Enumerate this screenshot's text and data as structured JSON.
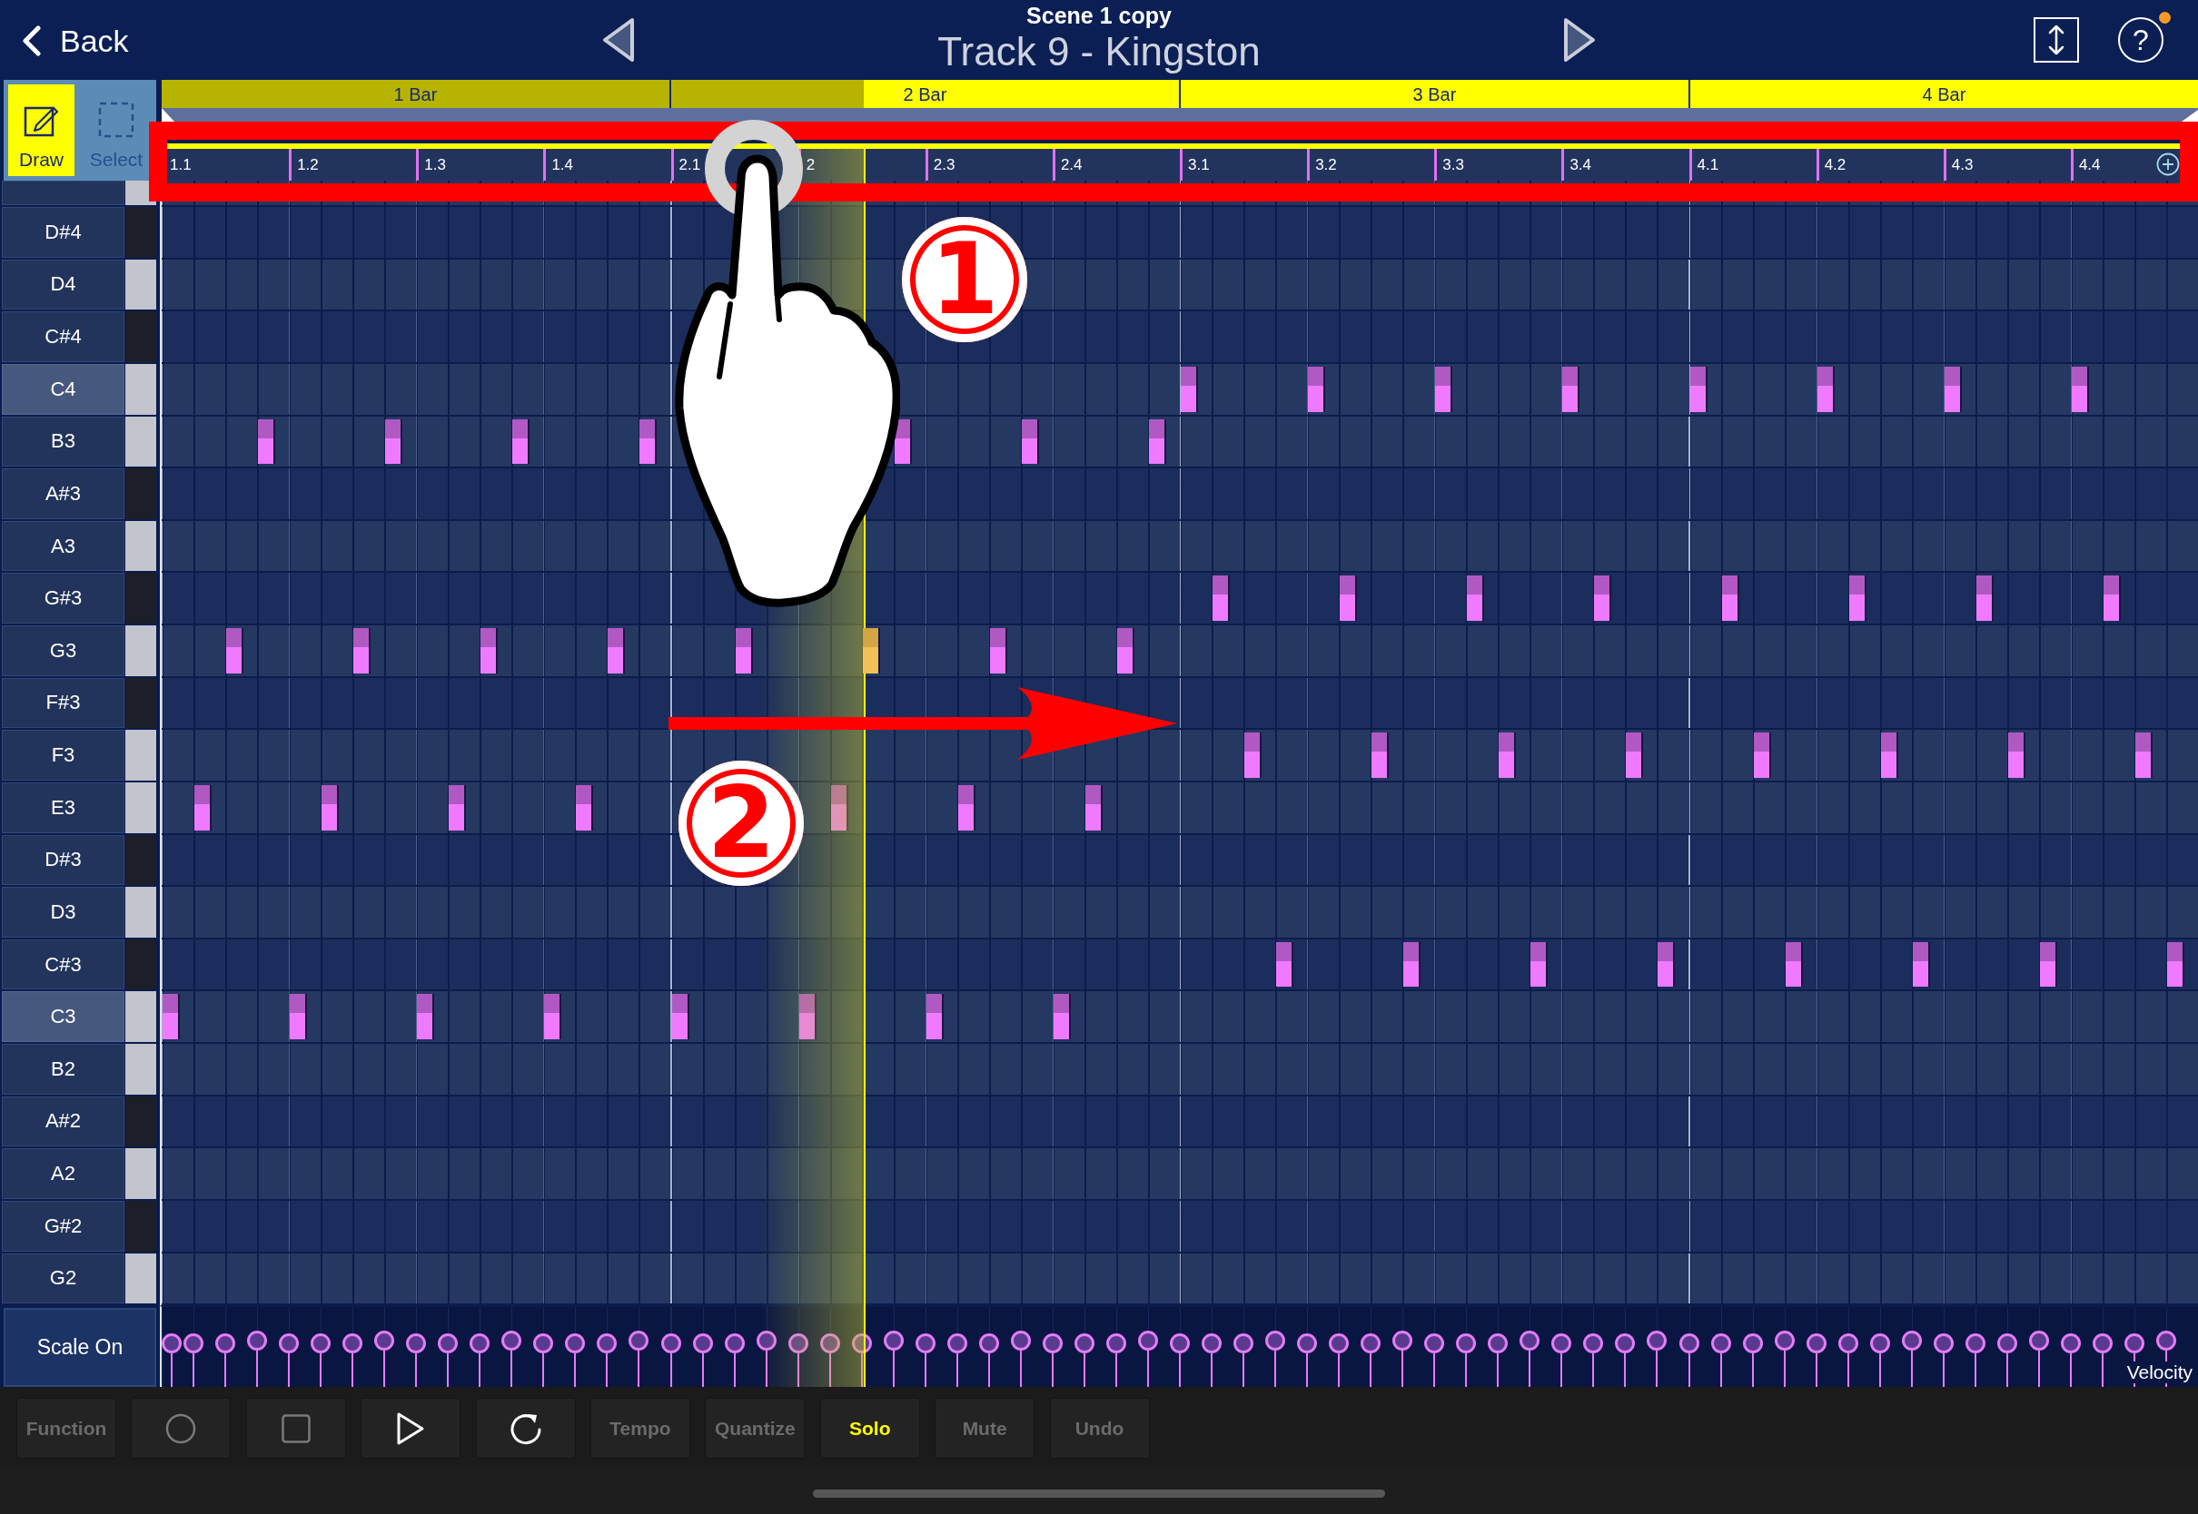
{
  "header": {
    "back": {
      "label": "Back"
    },
    "scene": "Scene 1 copy",
    "track": "Track 9 - Kingston",
    "help": {
      "symbol": "?",
      "notification": true
    }
  },
  "tools": [
    {
      "kind": "draw",
      "label": "Draw",
      "selected": true
    },
    {
      "kind": "select",
      "label": "Select",
      "selected": false
    }
  ],
  "playhead": {
    "level": 0.345
  },
  "bar_ruler": {
    "bars": [
      {
        "label": "1 Bar"
      },
      {
        "label": "2 Bar"
      },
      {
        "label": "3 Bar"
      },
      {
        "label": "4 Bar"
      }
    ]
  },
  "beat_ruler": {
    "beats": [
      {
        "label": "1.1"
      },
      {
        "label": "1.2"
      },
      {
        "label": "1.3"
      },
      {
        "label": "1.4"
      },
      {
        "label": "2.1"
      },
      {
        "label": "2"
      },
      {
        "label": "2.3"
      },
      {
        "label": "2.4"
      },
      {
        "label": "3.1"
      },
      {
        "label": "3.2"
      },
      {
        "label": "3.3"
      },
      {
        "label": "3.4"
      },
      {
        "label": "4.1"
      },
      {
        "label": "4.2"
      },
      {
        "label": "4.3"
      },
      {
        "label": "4.4"
      }
    ]
  },
  "piano_roll": {
    "rows": [
      {
        "kind": "white",
        "highlighted": false
      },
      {
        "note": "D#4",
        "kind": "black",
        "highlighted": false
      },
      {
        "note": "D4",
        "kind": "white",
        "highlighted": false
      },
      {
        "note": "C#4",
        "kind": "black",
        "highlighted": false
      },
      {
        "note": "C4",
        "kind": "white",
        "highlighted": true,
        "notes": [
          {
            "level": 0.5,
            "playing": false
          },
          {
            "level": 0.5625,
            "playing": false
          },
          {
            "level": 0.625,
            "playing": false
          },
          {
            "level": 0.6875,
            "playing": false
          },
          {
            "level": 0.75,
            "playing": false
          },
          {
            "level": 0.8125,
            "playing": false
          },
          {
            "level": 0.875,
            "playing": false
          },
          {
            "level": 0.9375,
            "playing": false
          }
        ]
      },
      {
        "note": "B3",
        "kind": "white",
        "highlighted": false,
        "notes": [
          {
            "level": 0.046875,
            "playing": false
          },
          {
            "level": 0.109375,
            "playing": false
          },
          {
            "level": 0.171875,
            "playing": false
          },
          {
            "level": 0.234375,
            "playing": false
          },
          {
            "level": 0.359375,
            "playing": false
          },
          {
            "level": 0.421875,
            "playing": false
          },
          {
            "level": 0.484375,
            "playing": false
          }
        ]
      },
      {
        "note": "A#3",
        "kind": "black",
        "highlighted": false
      },
      {
        "note": "A3",
        "kind": "white",
        "highlighted": false
      },
      {
        "note": "G#3",
        "kind": "black",
        "highlighted": false,
        "notes": [
          {
            "level": 0.515625,
            "playing": false
          },
          {
            "level": 0.578125,
            "playing": false
          },
          {
            "level": 0.640625,
            "playing": false
          },
          {
            "level": 0.703125,
            "playing": false
          },
          {
            "level": 0.765625,
            "playing": false
          },
          {
            "level": 0.828125,
            "playing": false
          },
          {
            "level": 0.890625,
            "playing": false
          },
          {
            "level": 0.953125,
            "playing": false
          }
        ]
      },
      {
        "note": "G3",
        "kind": "white",
        "highlighted": false,
        "notes": [
          {
            "level": 0.03125,
            "playing": false
          },
          {
            "level": 0.09375,
            "playing": false
          },
          {
            "level": 0.15625,
            "playing": false
          },
          {
            "level": 0.21875,
            "playing": false
          },
          {
            "level": 0.28125,
            "playing": false
          },
          {
            "level": 0.34375,
            "playing": true
          },
          {
            "level": 0.40625,
            "playing": false
          },
          {
            "level": 0.46875,
            "playing": false
          }
        ]
      },
      {
        "note": "F#3",
        "kind": "black",
        "highlighted": false
      },
      {
        "note": "F3",
        "kind": "white",
        "highlighted": false,
        "notes": [
          {
            "level": 0.53125,
            "playing": false
          },
          {
            "level": 0.59375,
            "playing": false
          },
          {
            "level": 0.65625,
            "playing": false
          },
          {
            "level": 0.71875,
            "playing": false
          },
          {
            "level": 0.78125,
            "playing": false
          },
          {
            "level": 0.84375,
            "playing": false
          },
          {
            "level": 0.90625,
            "playing": false
          },
          {
            "level": 0.96875,
            "playing": false
          }
        ]
      },
      {
        "note": "E3",
        "kind": "white",
        "highlighted": false,
        "notes": [
          {
            "level": 0.015625,
            "playing": false
          },
          {
            "level": 0.078125,
            "playing": false
          },
          {
            "level": 0.140625,
            "playing": false
          },
          {
            "level": 0.203125,
            "playing": false
          },
          {
            "level": 0.328125,
            "playing": false
          },
          {
            "level": 0.390625,
            "playing": false
          },
          {
            "level": 0.453125,
            "playing": false
          }
        ]
      },
      {
        "note": "D#3",
        "kind": "black",
        "highlighted": false
      },
      {
        "note": "D3",
        "kind": "white",
        "highlighted": false
      },
      {
        "note": "C#3",
        "kind": "black",
        "highlighted": false,
        "notes": [
          {
            "level": 0.546875,
            "playing": false
          },
          {
            "level": 0.609375,
            "playing": false
          },
          {
            "level": 0.671875,
            "playing": false
          },
          {
            "level": 0.734375,
            "playing": false
          },
          {
            "level": 0.796875,
            "playing": false
          },
          {
            "level": 0.859375,
            "playing": false
          },
          {
            "level": 0.921875,
            "playing": false
          },
          {
            "level": 0.984375,
            "playing": false
          }
        ]
      },
      {
        "note": "C3",
        "kind": "white",
        "highlighted": true,
        "notes": [
          {
            "level": 0,
            "playing": false
          },
          {
            "level": 0.0625,
            "playing": false
          },
          {
            "level": 0.125,
            "playing": false
          },
          {
            "level": 0.1875,
            "playing": false
          },
          {
            "level": 0.25,
            "playing": false
          },
          {
            "level": 0.3125,
            "playing": false
          },
          {
            "level": 0.375,
            "playing": false
          },
          {
            "level": 0.4375,
            "playing": false
          }
        ]
      },
      {
        "note": "B2",
        "kind": "white",
        "highlighted": false
      },
      {
        "note": "A#2",
        "kind": "black",
        "highlighted": false
      },
      {
        "note": "A2",
        "kind": "white",
        "highlighted": false
      },
      {
        "note": "G#2",
        "kind": "black",
        "highlighted": false
      },
      {
        "note": "G2",
        "kind": "white",
        "highlighted": false
      }
    ]
  },
  "scale_button": {
    "label": "Scale On"
  },
  "velocity_lane": {
    "label": "Velocity",
    "markers": [
      {
        "level": 0.55
      },
      {
        "level": 0.55
      },
      {
        "level": 0.55
      },
      {
        "level": 0.58
      },
      {
        "level": 0.55
      },
      {
        "level": 0.55
      },
      {
        "level": 0.55
      },
      {
        "level": 0.58
      },
      {
        "level": 0.55
      },
      {
        "level": 0.55
      },
      {
        "level": 0.55
      },
      {
        "level": 0.58
      },
      {
        "level": 0.55
      },
      {
        "level": 0.55
      },
      {
        "level": 0.55
      },
      {
        "level": 0.58
      },
      {
        "level": 0.55
      },
      {
        "level": 0.55
      },
      {
        "level": 0.55
      },
      {
        "level": 0.58
      },
      {
        "level": 0.55
      },
      {
        "level": 0.55
      },
      {
        "level": 0.55
      },
      {
        "level": 0.58
      },
      {
        "level": 0.55
      },
      {
        "level": 0.55
      },
      {
        "level": 0.55
      },
      {
        "level": 0.58
      },
      {
        "level": 0.55
      },
      {
        "level": 0.55
      },
      {
        "level": 0.55
      },
      {
        "level": 0.58
      },
      {
        "level": 0.55
      },
      {
        "level": 0.55
      },
      {
        "level": 0.55
      },
      {
        "level": 0.58
      },
      {
        "level": 0.55
      },
      {
        "level": 0.55
      },
      {
        "level": 0.55
      },
      {
        "level": 0.58
      },
      {
        "level": 0.55
      },
      {
        "level": 0.55
      },
      {
        "level": 0.55
      },
      {
        "level": 0.58
      },
      {
        "level": 0.55
      },
      {
        "level": 0.55
      },
      {
        "level": 0.55
      },
      {
        "level": 0.58
      },
      {
        "level": 0.55
      },
      {
        "level": 0.55
      },
      {
        "level": 0.55
      },
      {
        "level": 0.58
      },
      {
        "level": 0.55
      },
      {
        "level": 0.55
      },
      {
        "level": 0.55
      },
      {
        "level": 0.58
      },
      {
        "level": 0.55
      },
      {
        "level": 0.55
      },
      {
        "level": 0.55
      },
      {
        "level": 0.58
      },
      {
        "level": 0.55
      },
      {
        "level": 0.55
      },
      {
        "level": 0.55
      },
      {
        "level": 0.58
      }
    ]
  },
  "toolbar": [
    {
      "kind": "text",
      "label": "Function",
      "on": false,
      "disabled": false
    },
    {
      "kind": "record",
      "on": false,
      "disabled": true
    },
    {
      "kind": "stop",
      "on": false,
      "disabled": true
    },
    {
      "kind": "play",
      "on": false,
      "disabled": false
    },
    {
      "kind": "loop",
      "on": false,
      "disabled": false
    },
    {
      "kind": "text",
      "label": "Tempo",
      "on": false,
      "disabled": false
    },
    {
      "kind": "text",
      "label": "Quantize",
      "on": false,
      "disabled": false
    },
    {
      "kind": "text",
      "label": "Solo",
      "on": true,
      "disabled": false
    },
    {
      "kind": "text",
      "label": "Mute",
      "on": false,
      "disabled": false
    },
    {
      "kind": "text",
      "label": "Undo",
      "on": false,
      "disabled": false
    }
  ],
  "callouts": [
    {
      "label": "1"
    },
    {
      "label": "2"
    }
  ]
}
